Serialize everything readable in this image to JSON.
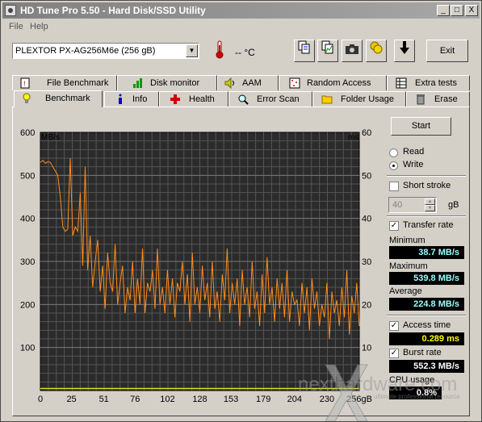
{
  "window": {
    "title": "HD Tune Pro 5.50 - Hard Disk/SSD Utility",
    "min": "_",
    "max": "□",
    "close": "X"
  },
  "menu": {
    "file": "File",
    "help": "Help"
  },
  "toolbar": {
    "drive": "PLEXTOR PX-AG256M6e (256 gB)",
    "temperature": "-- °C",
    "exit": "Exit"
  },
  "tabs_top": [
    {
      "label": "File Benchmark",
      "icon": "file-benchmark-icon"
    },
    {
      "label": "Disk monitor",
      "icon": "disk-monitor-icon"
    },
    {
      "label": "AAM",
      "icon": "speaker-icon"
    },
    {
      "label": "Random Access",
      "icon": "random-access-icon"
    },
    {
      "label": "Extra tests",
      "icon": "extra-tests-icon"
    }
  ],
  "tabs_bottom": [
    {
      "label": "Benchmark",
      "icon": "benchmark-icon"
    },
    {
      "label": "Info",
      "icon": "info-icon"
    },
    {
      "label": "Health",
      "icon": "health-icon"
    },
    {
      "label": "Error Scan",
      "icon": "error-scan-icon"
    },
    {
      "label": "Folder Usage",
      "icon": "folder-icon"
    },
    {
      "label": "Erase",
      "icon": "erase-icon"
    }
  ],
  "controls": {
    "start": "Start",
    "read": "Read",
    "write": "Write",
    "mode": "write",
    "short_stroke": "Short stroke",
    "short_stroke_checked": false,
    "stroke_value": "40",
    "stroke_unit": "gB",
    "transfer_rate": "Transfer rate",
    "transfer_rate_checked": true,
    "minimum_label": "Minimum",
    "minimum": "38.7 MB/s",
    "maximum_label": "Maximum",
    "maximum": "539.8 MB/s",
    "average_label": "Average",
    "average": "224.8 MB/s",
    "access_time": "Access time",
    "access_time_checked": true,
    "access_value": "0.289 ms",
    "burst_rate": "Burst rate",
    "burst_rate_checked": true,
    "burst_value": "552.3 MB/s",
    "cpu_label": "CPU usage",
    "cpu_value": "0.8%"
  },
  "watermark": {
    "brand": "nexthardware.com",
    "tagline": "ultimate professional resource"
  },
  "chart_data": {
    "type": "line",
    "ylabel_left": "MB/s",
    "ylabel_right": "ms",
    "ylim_left": [
      0,
      600
    ],
    "ylim_right": [
      0,
      60
    ],
    "yticks_left": [
      "600",
      "500",
      "400",
      "300",
      "200",
      "100"
    ],
    "yticks_right": [
      "60",
      "50",
      "40",
      "30",
      "20",
      "10"
    ],
    "xticks": [
      "0",
      "25",
      "51",
      "76",
      "102",
      "128",
      "153",
      "179",
      "204",
      "230",
      "256gB"
    ],
    "xlim": [
      0,
      256
    ],
    "grid": true,
    "series": [
      {
        "name": "Transfer rate",
        "color": "#ff8c1a",
        "x": [
          0,
          2,
          4,
          6,
          8,
          10,
          12,
          14,
          16,
          18,
          20,
          22,
          24,
          26,
          28,
          30,
          32,
          34,
          36,
          38,
          40,
          42,
          44,
          46,
          48,
          50,
          52,
          54,
          56,
          58,
          60,
          62,
          64,
          66,
          68,
          70,
          72,
          74,
          76,
          78,
          80,
          82,
          84,
          86,
          88,
          90,
          92,
          94,
          96,
          98,
          100,
          102,
          104,
          106,
          108,
          110,
          112,
          114,
          116,
          118,
          120,
          122,
          124,
          126,
          128,
          130,
          132,
          134,
          136,
          138,
          140,
          142,
          144,
          146,
          148,
          150,
          152,
          154,
          156,
          158,
          160,
          162,
          164,
          166,
          168,
          170,
          172,
          174,
          176,
          178,
          180,
          182,
          184,
          186,
          188,
          190,
          192,
          194,
          196,
          198,
          200,
          202,
          204,
          206,
          208,
          210,
          212,
          214,
          216,
          218,
          220,
          222,
          224,
          226,
          228,
          230,
          232,
          234,
          236,
          238,
          240,
          242,
          244,
          246,
          248,
          250,
          252,
          254,
          256
        ],
        "values": [
          530,
          535,
          528,
          532,
          530,
          520,
          510,
          500,
          450,
          380,
          370,
          375,
          540,
          360,
          380,
          370,
          460,
          290,
          520,
          280,
          360,
          240,
          300,
          350,
          230,
          290,
          190,
          320,
          250,
          230,
          340,
          200,
          250,
          290,
          180,
          240,
          210,
          300,
          180,
          260,
          200,
          330,
          180,
          250,
          230,
          280,
          190,
          330,
          200,
          240,
          180,
          280,
          200,
          260,
          170,
          250,
          230,
          300,
          200,
          270,
          160,
          320,
          200,
          240,
          180,
          290,
          210,
          250,
          170,
          300,
          190,
          230,
          160,
          270,
          210,
          330,
          180,
          250,
          200,
          260,
          150,
          280,
          200,
          240,
          170,
          300,
          190,
          230,
          150,
          270,
          180,
          310,
          200,
          240,
          160,
          260,
          190,
          250,
          170,
          280,
          160,
          230,
          200,
          210,
          150,
          250,
          180,
          240,
          140,
          260,
          190,
          230,
          150,
          200,
          170,
          250,
          120,
          230,
          180,
          210,
          150,
          240,
          170,
          280,
          130,
          220,
          180,
          250,
          150
        ]
      },
      {
        "name": "Access time",
        "color": "#e0e020",
        "x": [
          0,
          256
        ],
        "values": [
          0.289,
          0.289
        ]
      }
    ]
  }
}
